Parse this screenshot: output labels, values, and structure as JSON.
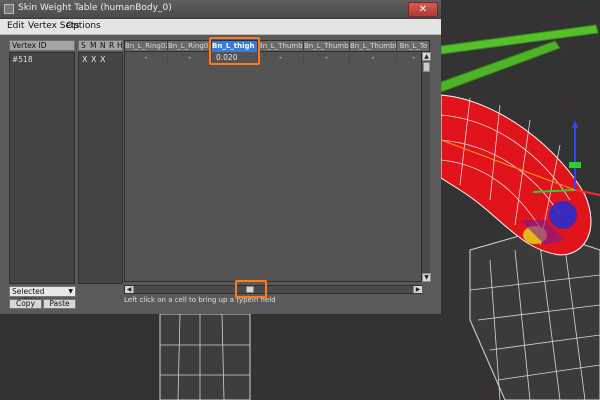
{
  "window": {
    "title": "Skin Weight Table (humanBody_0)",
    "close_glyph": "✕"
  },
  "menu": {
    "items": [
      "Edit",
      "Vertex Sets",
      "Options"
    ]
  },
  "left_panel": {
    "header": "Vertex ID",
    "rows": [
      "#518"
    ]
  },
  "flags": {
    "headers": [
      "S",
      "M",
      "N",
      "R",
      "H"
    ],
    "row": [
      "X",
      "X",
      "X",
      "",
      ""
    ]
  },
  "grid": {
    "columns": [
      "Bn_L_Ring02",
      "Bn_L_Ring03",
      "Bn_L_thigh 01",
      "Bn_L_Thumb01",
      "Bn_L_Thumb02",
      "Bn_L_Thumb03",
      "Bn_L_To"
    ],
    "selected_column": 2,
    "row": [
      "-",
      "-",
      "0.020",
      "-",
      "-",
      "-",
      "-"
    ]
  },
  "hint": "Left click on a cell to bring up a typein field",
  "controls": {
    "selection_mode": "Selected vertices",
    "copy": "Copy",
    "paste": "Paste"
  },
  "colors": {
    "accent": "#3b7ad6",
    "annotation": "#ff7a1a"
  },
  "icons": {
    "scroll_up": "▲",
    "scroll_down": "▼",
    "scroll_left": "◀",
    "scroll_right": "▶",
    "dropdown": "▼"
  }
}
